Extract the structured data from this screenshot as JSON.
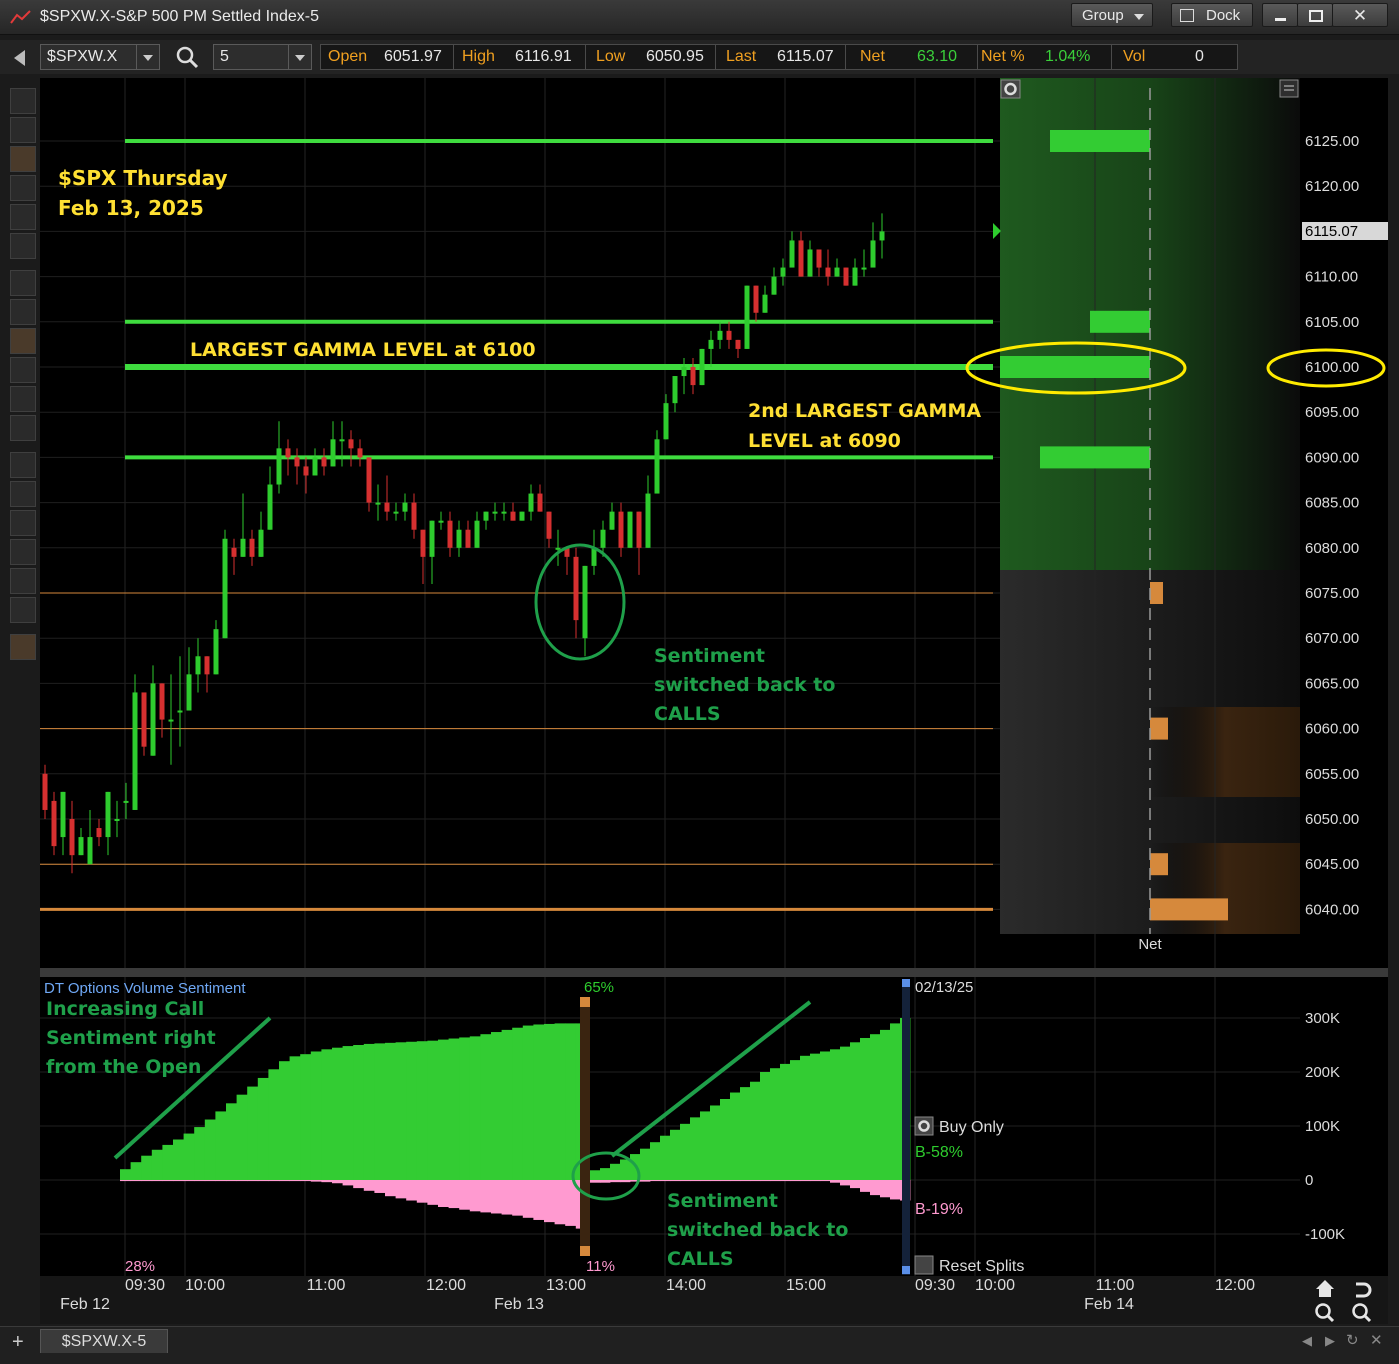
{
  "window": {
    "title": "$SPXW.X-S&P 500 PM Settled Index-5",
    "group_label": "Group",
    "dock_label": "Dock"
  },
  "toolbar": {
    "symbol": "$SPXW.X",
    "interval": "5",
    "quote": {
      "open_label": "Open",
      "open": "6051.97",
      "high_label": "High",
      "high": "6116.91",
      "low_label": "Low",
      "low": "6050.95",
      "last_label": "Last",
      "last": "6115.07",
      "net_label": "Net",
      "net": "63.10",
      "netpct_label": "Net %",
      "netpct": "1.04%",
      "vol_label": "Vol",
      "vol": "0"
    }
  },
  "colors": {
    "background": "#000000",
    "up": "#2ecc2e",
    "down": "#d63030",
    "gamma_line": "#3fdc3f",
    "put_level": "#d6893c",
    "callout": "#ffe033",
    "annotation_green": "#2ebd4a",
    "pink": "#ff9ad0",
    "highlight": "#ffeb00"
  },
  "annotations": {
    "title1": "$SPX Thursday",
    "title2": "Feb 13, 2025",
    "largest_gamma": "LARGEST GAMMA LEVEL at 6100",
    "second_gamma1": "2nd LARGEST GAMMA",
    "second_gamma2": "LEVEL at 6090",
    "sentiment_top1": "Sentiment",
    "sentiment_top2": "switched back to",
    "sentiment_top3": "CALLS",
    "increasing1": "Increasing Call",
    "increasing2": "Sentiment right",
    "increasing3": "from the Open",
    "sentiment_bot1": "Sentiment",
    "sentiment_bot2": "switched back to",
    "sentiment_bot3": "CALLS"
  },
  "chart_data": [
    {
      "type": "candlestick",
      "title": "$SPXW.X-S&P 500 PM Settled Index-5",
      "ylim": [
        6035.0,
        6128.0
      ],
      "y_ticks": [
        "6125.00",
        "6120.00",
        "6115.00",
        "6110.00",
        "6105.00",
        "6100.00",
        "6095.00",
        "6090.00",
        "6085.00",
        "6080.00",
        "6075.00",
        "6070.00",
        "6065.00",
        "6060.00",
        "6055.00",
        "6050.00",
        "6045.00",
        "6040.00"
      ],
      "last_price_label": "6115.07",
      "x_time_labels": [
        "09:30",
        "10:00",
        "11:00",
        "12:00",
        "13:00",
        "14:00",
        "15:00",
        "09:30",
        "10:00",
        "11:00",
        "12:00"
      ],
      "x_date_labels": [
        "Feb 12",
        "Feb 13",
        "Feb 14"
      ],
      "gamma_levels": [
        6125,
        6105,
        6100,
        6090
      ],
      "put_levels": [
        6075,
        6060,
        6045,
        6040
      ],
      "net_gamma": {
        "label": "Net",
        "bars": [
          {
            "strike": 6125,
            "value": 1.0,
            "side": "call"
          },
          {
            "strike": 6105,
            "value": 0.6,
            "side": "call"
          },
          {
            "strike": 6100,
            "value": 1.5,
            "side": "call"
          },
          {
            "strike": 6090,
            "value": 1.1,
            "side": "call"
          },
          {
            "strike": 6075,
            "value": 0.13,
            "side": "put"
          },
          {
            "strike": 6060,
            "value": 0.18,
            "side": "put"
          },
          {
            "strike": 6045,
            "value": 0.18,
            "side": "put"
          },
          {
            "strike": 6040,
            "value": 0.78,
            "side": "put"
          }
        ]
      },
      "candles": [
        [
          6055,
          6056,
          6050,
          6051
        ],
        [
          6052,
          6053,
          6046,
          6047
        ],
        [
          6048,
          6053,
          6046,
          6053
        ],
        [
          6050,
          6052,
          6044,
          6046
        ],
        [
          6046,
          6049,
          6046,
          6048
        ],
        [
          6045,
          6051,
          6045,
          6048
        ],
        [
          6049,
          6050,
          6047,
          6048
        ],
        [
          6048,
          6053,
          6046,
          6053
        ],
        [
          6050,
          6052,
          6048,
          6050
        ],
        [
          6052,
          6054,
          6050,
          6052
        ],
        [
          6051,
          6066,
          6051,
          6064
        ],
        [
          6064,
          6064,
          6057,
          6058
        ],
        [
          6057,
          6067,
          6057,
          6065
        ],
        [
          6065,
          6065,
          6059,
          6061
        ],
        [
          6061,
          6066,
          6056,
          6061
        ],
        [
          6062,
          6068,
          6058,
          6062
        ],
        [
          6062,
          6069,
          6062,
          6066
        ],
        [
          6066,
          6070,
          6064,
          6068
        ],
        [
          6068,
          6068,
          6064,
          6066
        ],
        [
          6066,
          6072,
          6066,
          6071
        ],
        [
          6070,
          6082,
          6070,
          6081
        ],
        [
          6080,
          6081,
          6077,
          6079
        ],
        [
          6079,
          6086,
          6079,
          6081
        ],
        [
          6081,
          6082,
          6078,
          6079
        ],
        [
          6079,
          6084,
          6079,
          6082
        ],
        [
          6082,
          6089,
          6082,
          6087
        ],
        [
          6087,
          6094,
          6086,
          6091
        ],
        [
          6091,
          6092,
          6088,
          6090
        ],
        [
          6090,
          6091,
          6087,
          6089
        ],
        [
          6089,
          6090,
          6086,
          6088
        ],
        [
          6088,
          6091,
          6088,
          6090
        ],
        [
          6090,
          6091,
          6088,
          6089
        ],
        [
          6089,
          6094,
          6089,
          6092
        ],
        [
          6092,
          6094,
          6089,
          6092
        ],
        [
          6092,
          6093,
          6089,
          6091
        ],
        [
          6091,
          6092,
          6089,
          6090
        ],
        [
          6090,
          6090,
          6084,
          6085
        ],
        [
          6085,
          6087,
          6083,
          6085
        ],
        [
          6085,
          6088,
          6083,
          6084
        ],
        [
          6084,
          6085,
          6083,
          6084
        ],
        [
          6084,
          6086,
          6083,
          6085
        ],
        [
          6085,
          6086,
          6081,
          6082
        ],
        [
          6082,
          6082,
          6076,
          6079
        ],
        [
          6079,
          6083,
          6076,
          6083
        ],
        [
          6083,
          6084,
          6082,
          6083
        ],
        [
          6083,
          6084,
          6079,
          6080
        ],
        [
          6080,
          6083,
          6079,
          6082
        ],
        [
          6082,
          6083,
          6080,
          6080
        ],
        [
          6080,
          6084,
          6080,
          6083
        ],
        [
          6083,
          6084,
          6082,
          6084
        ],
        [
          6084,
          6085,
          6083,
          6084
        ],
        [
          6084,
          6085,
          6083,
          6084
        ],
        [
          6084,
          6085,
          6083,
          6083
        ],
        [
          6083,
          6084,
          6083,
          6084
        ],
        [
          6084,
          6087,
          6083,
          6086
        ],
        [
          6086,
          6087,
          6084,
          6084
        ],
        [
          6084,
          6084,
          6080,
          6081
        ],
        [
          6080,
          6082,
          6078,
          6080
        ],
        [
          6080,
          6080,
          6077,
          6079
        ],
        [
          6079,
          6080,
          6070,
          6072
        ],
        [
          6070,
          6078,
          6068,
          6078
        ],
        [
          6078,
          6082,
          6077,
          6080
        ],
        [
          6080,
          6083,
          6079,
          6082
        ],
        [
          6082,
          6085,
          6082,
          6084
        ],
        [
          6084,
          6085,
          6079,
          6080
        ],
        [
          6080,
          6084,
          6080,
          6084
        ],
        [
          6084,
          6084,
          6077,
          6080
        ],
        [
          6080,
          6088,
          6080,
          6086
        ],
        [
          6086,
          6093,
          6086,
          6092
        ],
        [
          6092,
          6097,
          6092,
          6096
        ],
        [
          6096,
          6099,
          6095,
          6099
        ],
        [
          6099,
          6101,
          6097,
          6100
        ],
        [
          6100,
          6101,
          6097,
          6098
        ],
        [
          6098,
          6102,
          6098,
          6102
        ],
        [
          6102,
          6104,
          6100,
          6103
        ],
        [
          6103,
          6105,
          6102,
          6104
        ],
        [
          6104,
          6105,
          6102,
          6103
        ],
        [
          6103,
          6103,
          6101,
          6102
        ],
        [
          6102,
          6109,
          6102,
          6109
        ],
        [
          6109,
          6109,
          6105,
          6106
        ],
        [
          6106,
          6109,
          6106,
          6108
        ],
        [
          6108,
          6111,
          6108,
          6110
        ],
        [
          6110,
          6112,
          6109,
          6111
        ],
        [
          6111,
          6115,
          6111,
          6114
        ],
        [
          6114,
          6115,
          6110,
          6110
        ],
        [
          6110,
          6114,
          6110,
          6113
        ],
        [
          6113,
          6113,
          6110,
          6111
        ],
        [
          6111,
          6113,
          6109,
          6110
        ],
        [
          6110,
          6112,
          6110,
          6111
        ],
        [
          6111,
          6111,
          6109,
          6109
        ],
        [
          6109,
          6112,
          6109,
          6111
        ],
        [
          6111,
          6113,
          6110,
          6111
        ],
        [
          6111,
          6116,
          6111,
          6114
        ],
        [
          6114,
          6117,
          6112,
          6115
        ]
      ]
    },
    {
      "type": "bar",
      "title": "DT Options Volume Sentiment",
      "ylim": [
        -180000,
        330000
      ],
      "y_ticks": [
        "300K",
        "200K",
        "100K",
        "0",
        "-100K"
      ],
      "date_label": "02/13/25",
      "pct_labels": {
        "start": "28%",
        "switch_top": "65%",
        "switch_bottom": "11%"
      },
      "legend": {
        "mode": "Buy Only",
        "buy_call": "B-58%",
        "buy_put": "B-19%",
        "reset": "Reset Splits"
      },
      "series": [
        {
          "name": "calls",
          "values": [
            20000,
            33000,
            45000,
            56000,
            65000,
            75000,
            86000,
            98000,
            112000,
            127000,
            142000,
            158000,
            173000,
            189000,
            205000,
            220000,
            229000,
            233000,
            238000,
            242000,
            245000,
            248000,
            250000,
            252000,
            253000,
            254000,
            255000,
            256000,
            257000,
            258000,
            260000,
            262000,
            264000,
            266000,
            270000,
            274000,
            278000,
            282000,
            286000,
            288000,
            289000,
            290000,
            290000,
            290000,
            18000,
            22000,
            30000,
            38000,
            48000,
            58000,
            70000,
            82000,
            93000,
            104000,
            116000,
            127000,
            138000,
            150000,
            162000,
            172000,
            182000,
            200000,
            207000,
            215000,
            222000,
            230000,
            234000,
            238000,
            242000,
            247000,
            255000,
            263000,
            270000,
            278000,
            290000,
            300000
          ]
        },
        {
          "name": "puts",
          "values": [
            -2000,
            -2000,
            -2000,
            -2000,
            -2000,
            -2000,
            -2000,
            -2000,
            -2000,
            -2000,
            -2000,
            -2000,
            -2000,
            -2000,
            -2000,
            -2000,
            -2000,
            -2000,
            -3000,
            -4000,
            -6000,
            -10000,
            -15000,
            -20000,
            -24000,
            -30000,
            -34000,
            -38000,
            -42000,
            -46000,
            -50000,
            -52000,
            -55000,
            -58000,
            -60000,
            -62000,
            -64000,
            -66000,
            -70000,
            -74000,
            -78000,
            -82000,
            -85000,
            -90000,
            -5000,
            -5000,
            -4000,
            -4000,
            -3000,
            -3000,
            -2000,
            -2000,
            -2000,
            -2000,
            -2000,
            -2000,
            -2000,
            -2000,
            -2000,
            -2000,
            -2000,
            -2000,
            -2000,
            -2000,
            -2000,
            -2000,
            -2000,
            -2000,
            -5000,
            -10000,
            -15000,
            -22000,
            -28000,
            -32000,
            -36000,
            -38000
          ]
        }
      ]
    }
  ]
}
